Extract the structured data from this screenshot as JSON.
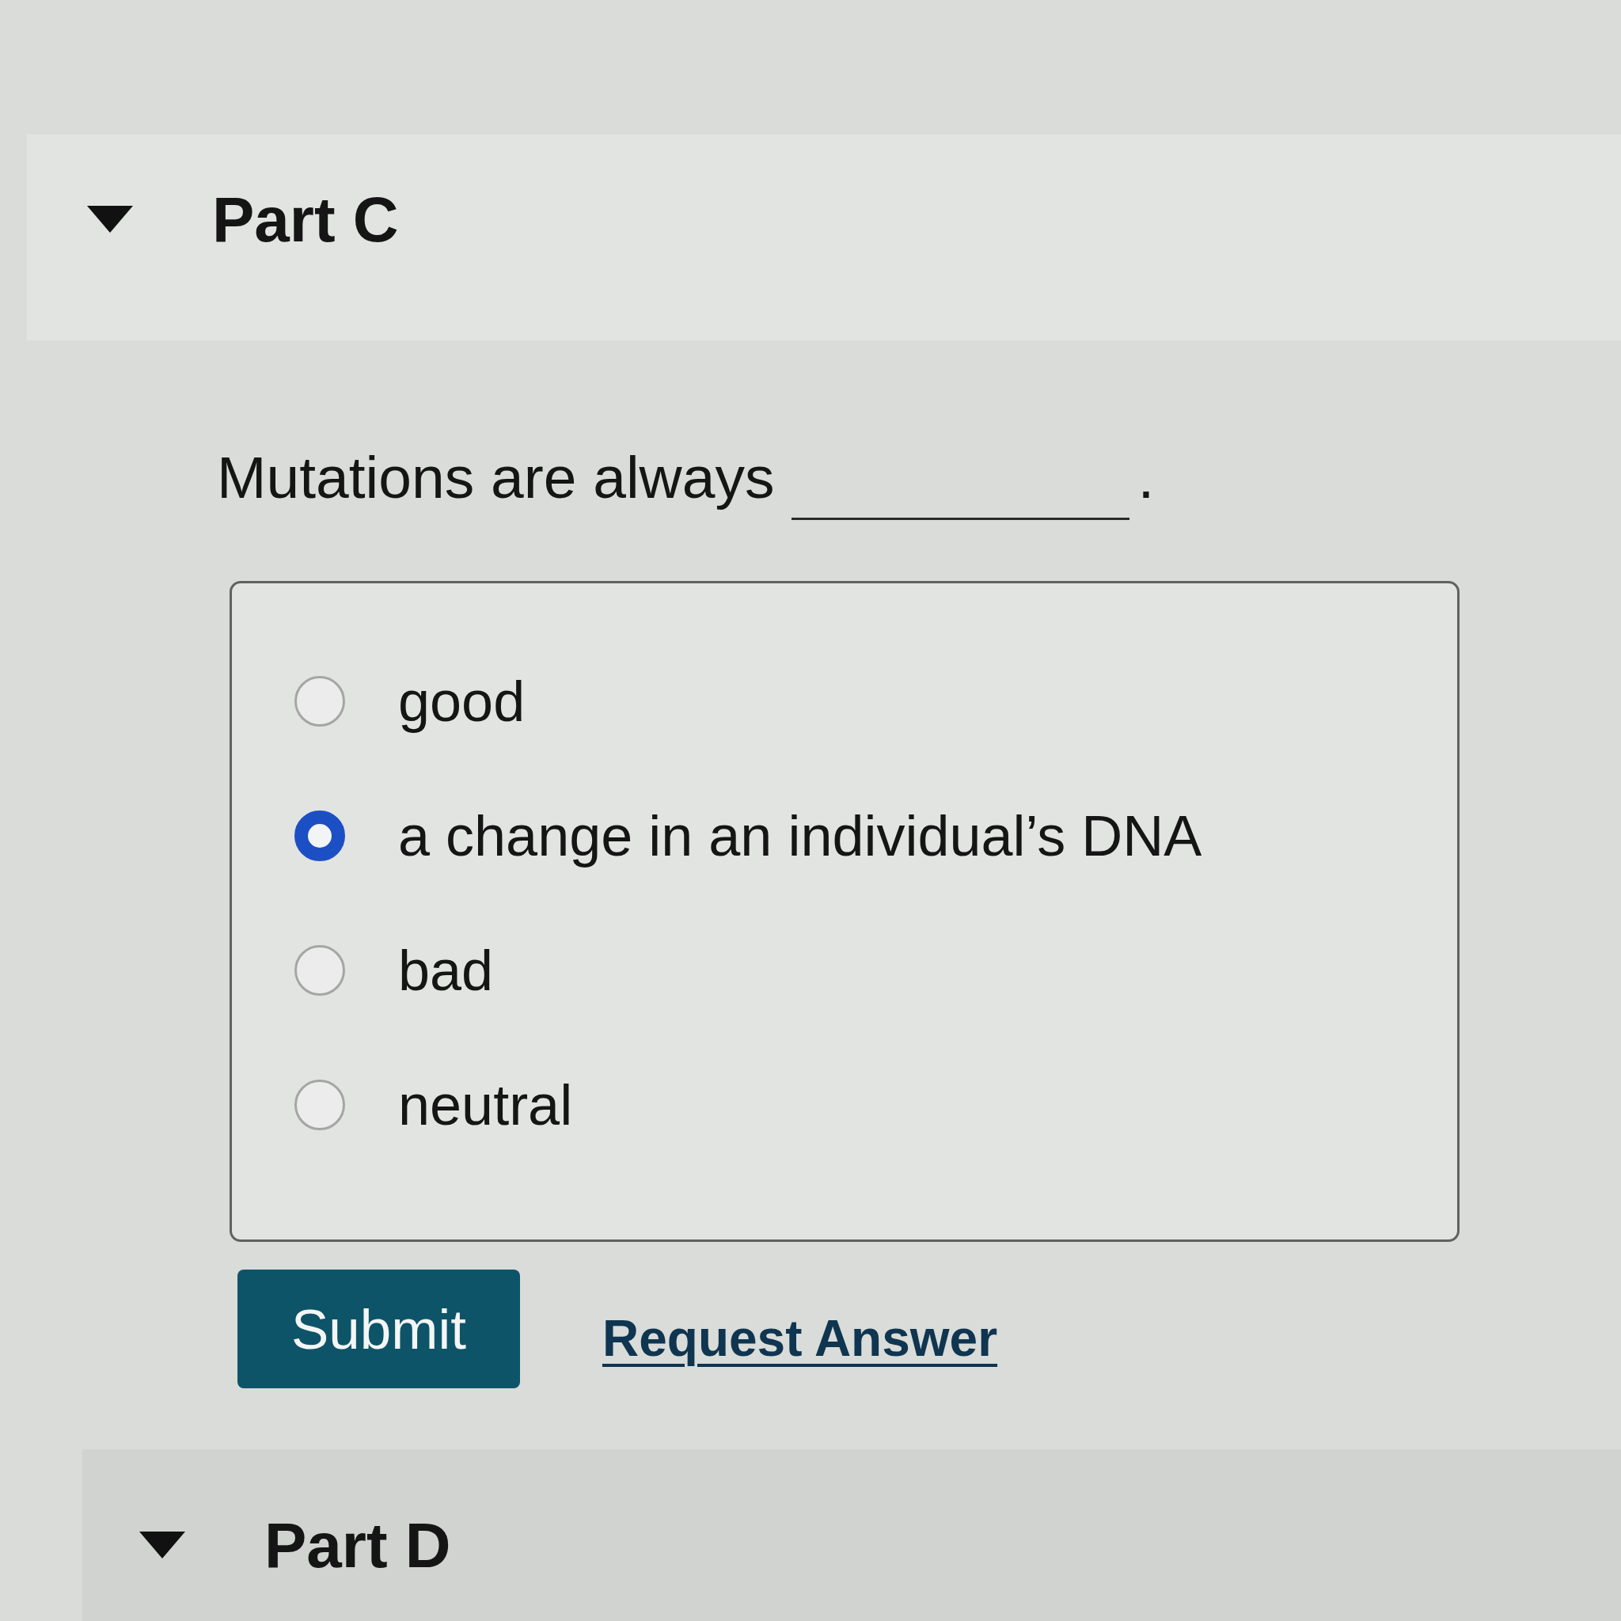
{
  "parts": [
    {
      "title": "Part C",
      "expanded": true,
      "question": {
        "segments": [
          {
            "kind": "text",
            "text": "Mutations are always"
          },
          {
            "kind": "blank"
          },
          {
            "kind": "text",
            "text": "."
          }
        ]
      },
      "options": [
        {
          "label": "good",
          "selected": false
        },
        {
          "label": "a change in an individual’s DNA",
          "selected": true
        },
        {
          "label": "bad",
          "selected": false
        },
        {
          "label": "neutral",
          "selected": false
        }
      ],
      "actions": [
        {
          "kind": "button",
          "label": "Submit"
        },
        {
          "kind": "link",
          "label": "Request Answer"
        }
      ]
    },
    {
      "title": "Part D",
      "expanded": true
    }
  ]
}
